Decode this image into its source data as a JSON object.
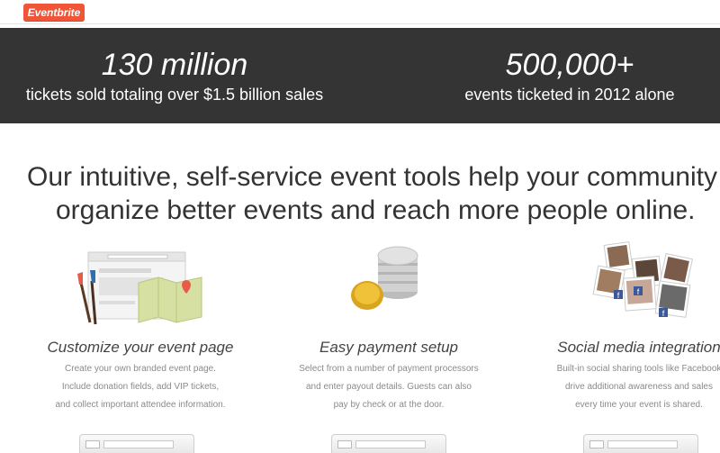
{
  "header": {
    "logo_text": "Eventbrite",
    "brand_color": "#f05537"
  },
  "stats": [
    {
      "value": "130 million",
      "label": "tickets sold totaling over $1.5 billion sales"
    },
    {
      "value": "500,000+",
      "label": "events ticketed in 2012 alone"
    }
  ],
  "headline": {
    "line1": "Our intuitive, self-service event tools help your community",
    "line2": "organize better events and reach more people online."
  },
  "features": [
    {
      "title": "Customize your event page",
      "lines": [
        "Create your own branded event page.",
        "Include donation fields, add VIP tickets,",
        "and collect important attendee information."
      ],
      "icon": "customize-illustration-icon"
    },
    {
      "title": "Easy payment setup",
      "lines": [
        "Select from a number of payment processors",
        "and enter payout details. Guests can also",
        "pay by check or at the door."
      ],
      "icon": "coins-icon"
    },
    {
      "title": "Social media integration",
      "lines": [
        "Built-in social sharing tools like Facebook",
        "drive additional awareness and sales",
        "every time your event is shared."
      ],
      "icon": "social-photos-icon"
    }
  ]
}
